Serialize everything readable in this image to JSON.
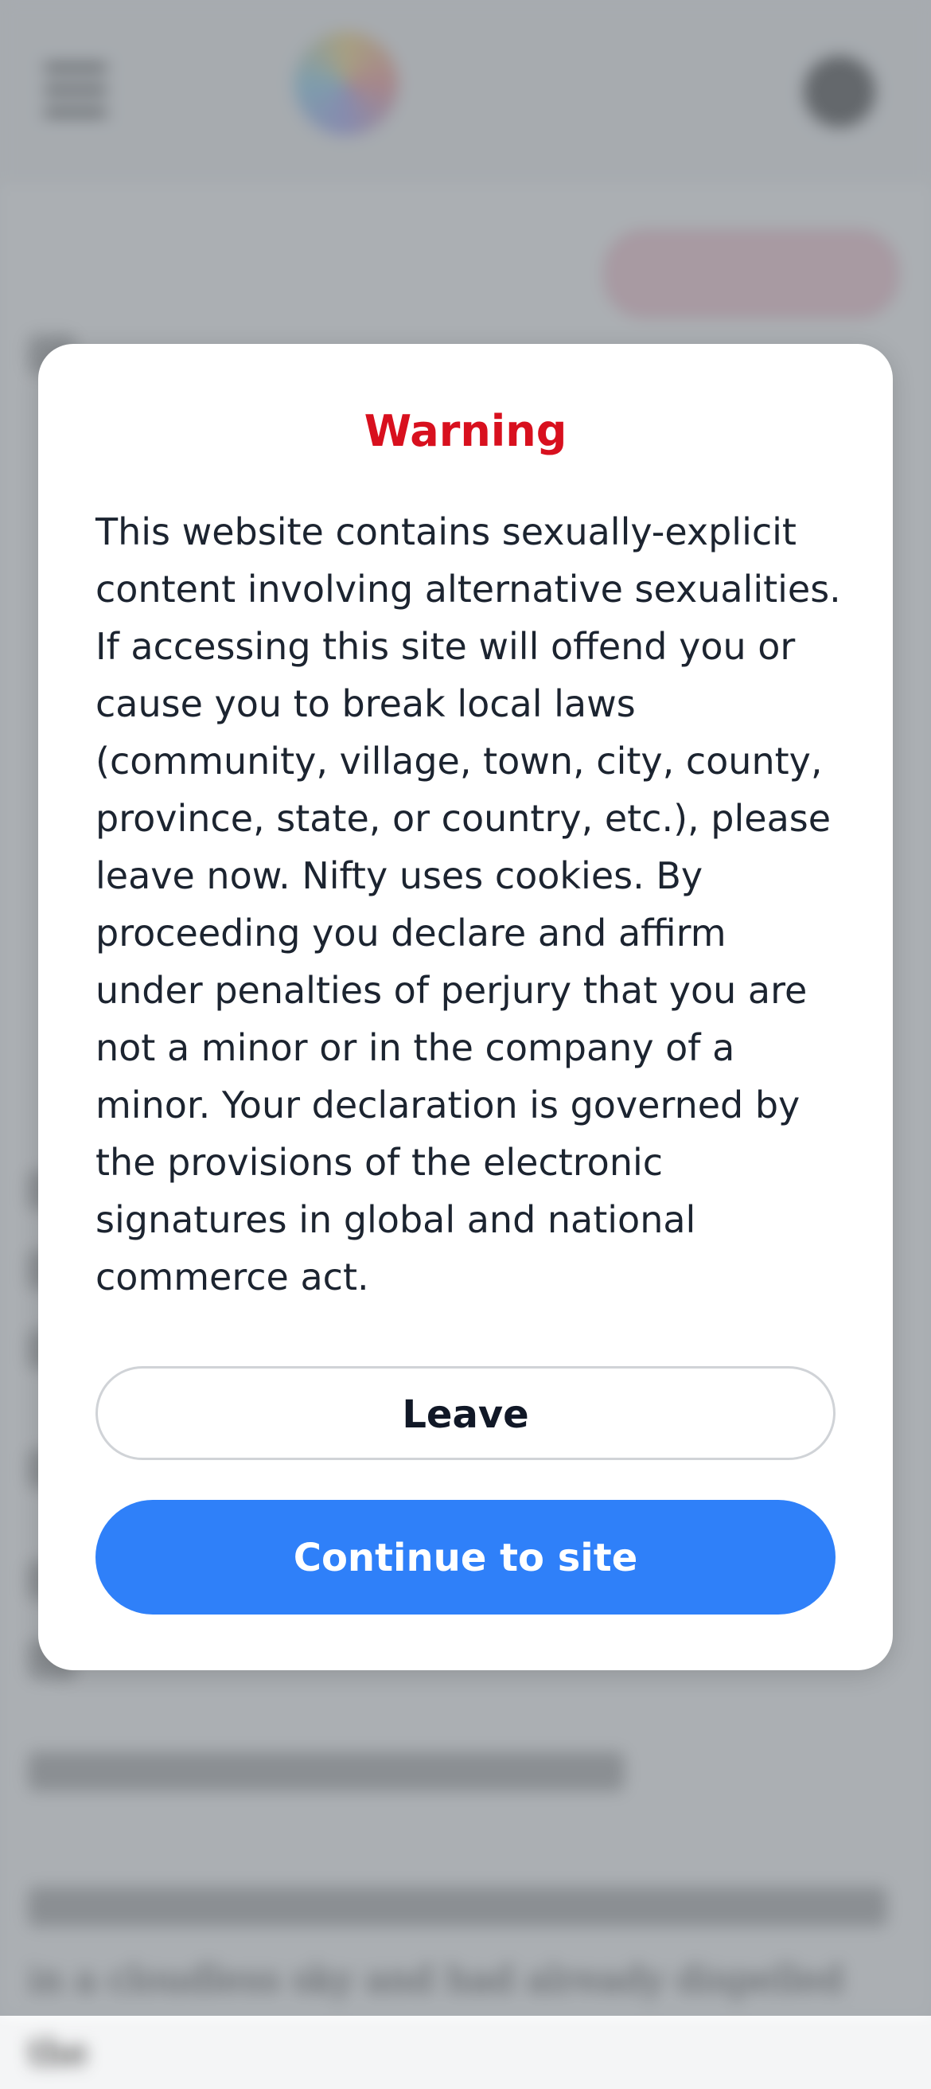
{
  "modal": {
    "title": "Warning",
    "body": "This website contains sexually-explicit content involving alternative sexualities. If accessing this site will offend you or cause you to break local laws (community, village, town, city, county, province, state, or country, etc.), please leave now. Nifty uses cookies. By proceeding you declare and affirm under penalties of perjury that you are not a minor or in the company of a minor. Your declaration is governed by the provisions of the electronic signatures in global and national commerce act.",
    "leave_label": "Leave",
    "continue_label": "Continue to site"
  },
  "background": {
    "bottom_text": "in a cloudless sky and had already dispelled the"
  },
  "colors": {
    "warning_title": "#d8101e",
    "primary_button": "#2f80f9",
    "overlay": "rgba(120,126,132,0.62)"
  },
  "icons": [
    "menu-icon",
    "site-logo",
    "avatar-icon"
  ]
}
